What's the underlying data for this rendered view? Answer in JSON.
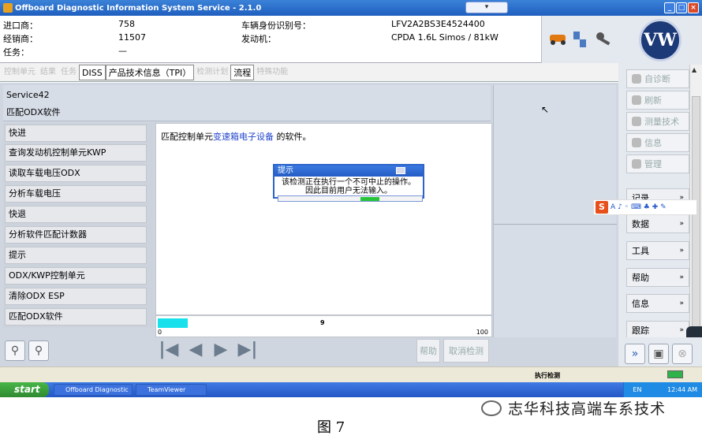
{
  "window": {
    "title": "Offboard Diagnostic Information System Service - 2.1.0",
    "dropdown_glyph": "▾",
    "min": "_",
    "max": "□",
    "close": "×"
  },
  "header": {
    "importer_label": "进口商：",
    "importer_value": "758",
    "dealer_label": "经销商：",
    "dealer_value": "11507",
    "task_label": "任务：",
    "task_value": "—",
    "vin_label": "车辆身份识别号：",
    "vin_value": "LFV2A2BS3E4524400",
    "engine_label": "发动机：",
    "engine_value": "CPDA 1.6L Simos / 81kW"
  },
  "logo": {
    "text": "VW"
  },
  "tabs": [
    {
      "label": "控制单元",
      "active": false
    },
    {
      "label": "结果",
      "active": false
    },
    {
      "label": "任务",
      "active": false
    },
    {
      "label": "DISS",
      "active": true
    },
    {
      "label": "产品技术信息（TPI）",
      "active": true
    },
    {
      "label": "检测计划",
      "active": false
    },
    {
      "label": "流程",
      "active": true
    },
    {
      "label": "特殊功能",
      "active": false
    }
  ],
  "service": {
    "line1": "Service42",
    "line2": "匹配ODX软件"
  },
  "steps": [
    "快进",
    "查询发动机控制单元KWP",
    "读取车载电压ODX",
    "分析车载电压",
    "快退",
    "分析软件匹配计数器",
    "提示",
    "ODX/KWP控制单元",
    "清除ODX ESP",
    "匹配ODX软件"
  ],
  "content": {
    "prefix": "匹配控制单元",
    "link": "变速箱电子设备",
    "suffix": " 的软件。"
  },
  "progress": {
    "min": "0",
    "max": "100",
    "current": "9",
    "fraction": 0.09
  },
  "dialog": {
    "title": "提示",
    "line1": "该检测正在执行一个不可中止的操作。",
    "line2": "因此目前用户无法输入。"
  },
  "bottom": {
    "help": "帮助",
    "cancel": "取消检测",
    "first": "|◀",
    "prev": "◀",
    "next": "▶",
    "last": "▶|"
  },
  "sidebar": {
    "buttons": [
      "自诊断",
      "刷新",
      "测量技术",
      "信息",
      "管理"
    ],
    "sections": [
      "记录",
      "数据",
      "工具",
      "帮助",
      "信息",
      "跟踪"
    ]
  },
  "ime": {
    "s": "S",
    "a": "A"
  },
  "status": {
    "center": "执行检测"
  },
  "taskbar": {
    "start": "start",
    "task1": "Offboard Diagnostic I...",
    "task2": "TeamViewer",
    "lang": "EN",
    "time": "12:44 AM"
  },
  "caption": {
    "figure": "图 7",
    "watermark": "志华科技高端车系技术"
  }
}
